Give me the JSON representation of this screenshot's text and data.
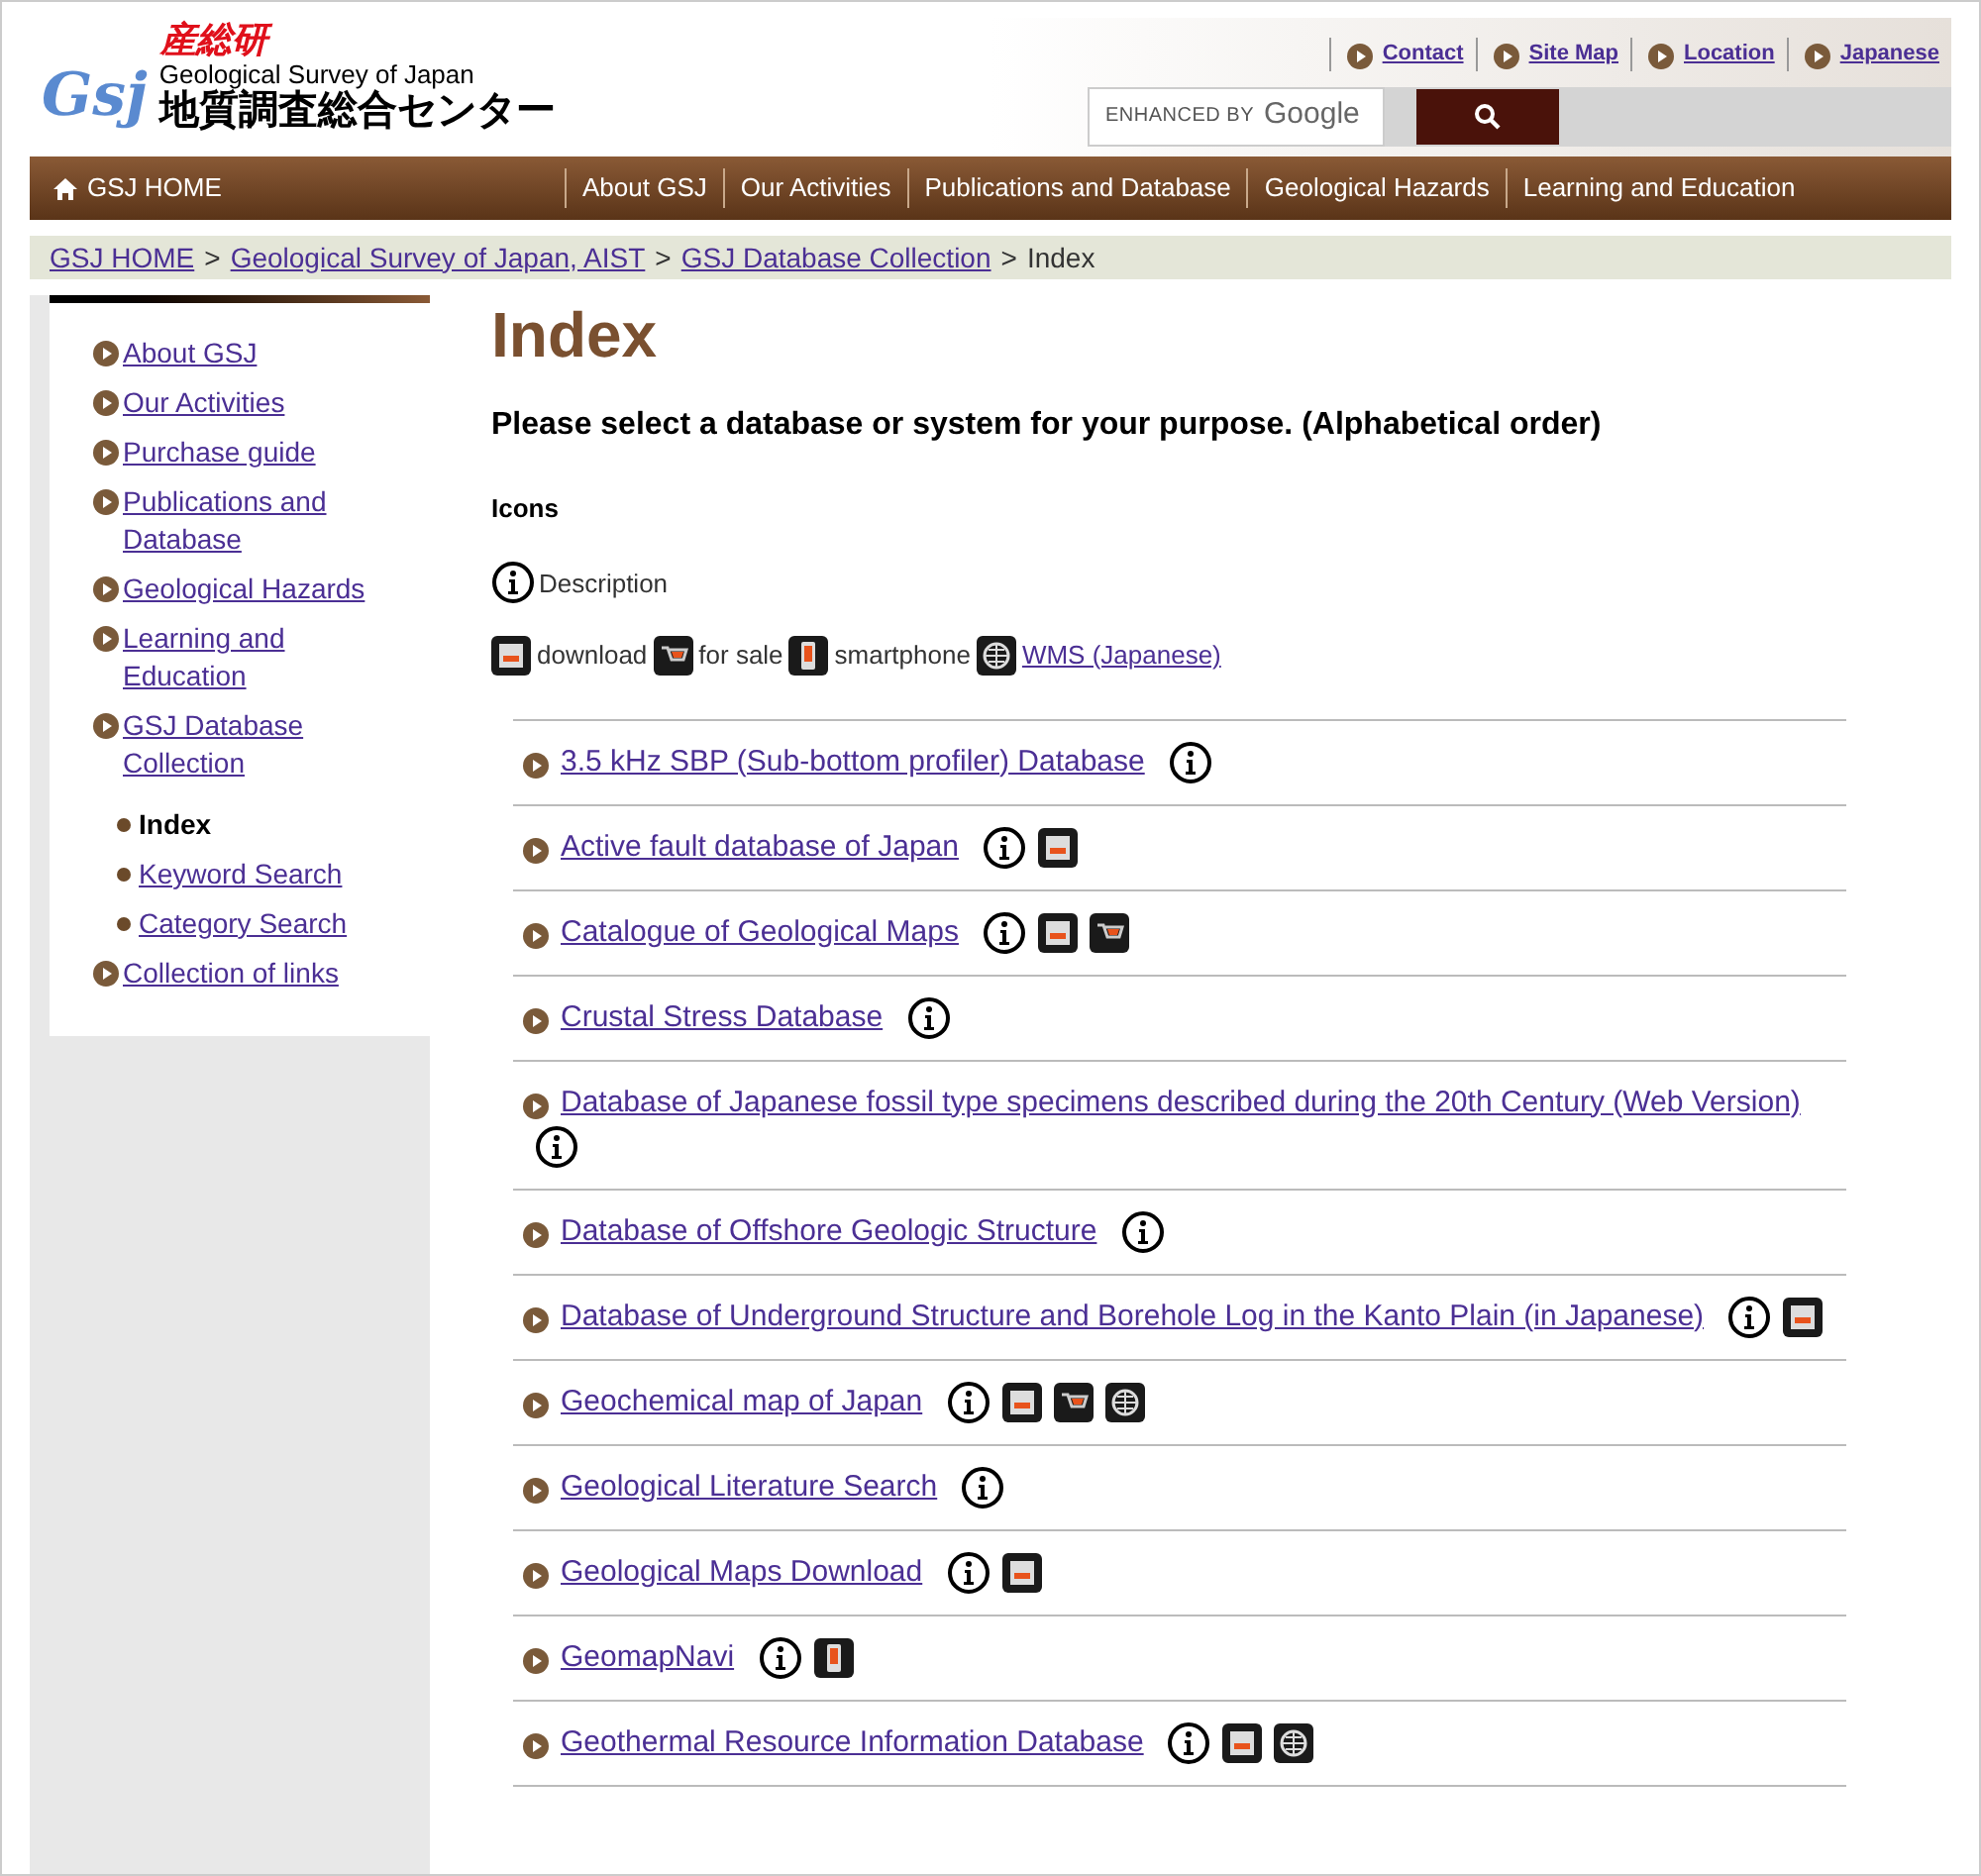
{
  "header": {
    "org_logo": "産総研",
    "gsj_logo": "Gsj",
    "name_en": "Geological Survey of Japan",
    "name_ja": "地質調査総合センター",
    "top_links": [
      "Contact",
      "Site Map",
      "Location",
      "Japanese"
    ],
    "search": {
      "placeholder_prefix": "ENHANCED BY",
      "placeholder_brand": "Google"
    }
  },
  "nav": [
    "GSJ HOME",
    "About GSJ",
    "Our Activities",
    "Publications and Database",
    "Geological Hazards",
    "Learning and Education"
  ],
  "breadcrumb": [
    {
      "label": "GSJ HOME",
      "link": true,
      "separator": ">"
    },
    {
      "label": "Geological Survey of Japan, AIST",
      "link": true,
      "separator": ">"
    },
    {
      "label": "GSJ Database Collection",
      "link": true,
      "separator": ">"
    },
    {
      "label": "Index",
      "link": false
    }
  ],
  "sidebar": {
    "items": [
      {
        "label": "About GSJ"
      },
      {
        "label": "Our Activities"
      },
      {
        "label": "Purchase guide"
      },
      {
        "label": "Publications and Database"
      },
      {
        "label": "Geological Hazards"
      },
      {
        "label": "Learning and Education"
      },
      {
        "label": "GSJ Database Collection",
        "children": [
          {
            "label": "Index",
            "selected": true
          },
          {
            "label": "Keyword Search",
            "selected": false
          },
          {
            "label": "Category Search",
            "selected": false
          }
        ]
      },
      {
        "label": "Collection of links"
      }
    ]
  },
  "main": {
    "title": "Index",
    "subtitle": "Please select a database or system for your purpose. (Alphabetical order)",
    "icons_heading": "Icons",
    "legend_description": "Description",
    "legend": [
      {
        "kind": "download",
        "label": "download",
        "link": false
      },
      {
        "kind": "sale",
        "label": "for sale",
        "link": false
      },
      {
        "kind": "smartphone",
        "label": "smartphone",
        "link": false
      },
      {
        "kind": "wms",
        "label": "WMS (Japanese)",
        "link": true
      }
    ],
    "databases": [
      {
        "label": "3.5 kHz SBP (Sub-bottom profiler) Database",
        "icons": [
          {
            "kind": "info"
          }
        ]
      },
      {
        "label": "Active fault database of Japan",
        "icons": [
          {
            "kind": "info"
          },
          {
            "kind": "download"
          }
        ]
      },
      {
        "label": "Catalogue of Geological Maps",
        "icons": [
          {
            "kind": "info"
          },
          {
            "kind": "download"
          },
          {
            "kind": "sale"
          }
        ]
      },
      {
        "label": "Crustal Stress Database",
        "icons": [
          {
            "kind": "info"
          }
        ]
      },
      {
        "label": "Database of Japanese fossil type specimens described during the 20th Century (Web Version)",
        "icons": [
          {
            "kind": "info"
          }
        ]
      },
      {
        "label": "Database of Offshore Geologic Structure",
        "icons": [
          {
            "kind": "info"
          }
        ]
      },
      {
        "label": "Database of Underground Structure and Borehole Log in the Kanto Plain (in Japanese)",
        "icons": [
          {
            "kind": "info"
          },
          {
            "kind": "download"
          }
        ]
      },
      {
        "label": "Geochemical map of Japan",
        "icons": [
          {
            "kind": "info"
          },
          {
            "kind": "download"
          },
          {
            "kind": "sale"
          },
          {
            "kind": "wms"
          }
        ]
      },
      {
        "label": "Geological Literature Search",
        "icons": [
          {
            "kind": "info"
          }
        ]
      },
      {
        "label": "Geological Maps Download",
        "icons": [
          {
            "kind": "info"
          },
          {
            "kind": "download"
          }
        ]
      },
      {
        "label": "GeomapNavi",
        "icons": [
          {
            "kind": "info"
          },
          {
            "kind": "smartphone"
          }
        ]
      },
      {
        "label": "Geothermal Resource Information Database",
        "icons": [
          {
            "kind": "info"
          },
          {
            "kind": "download"
          },
          {
            "kind": "wms"
          }
        ]
      }
    ]
  }
}
